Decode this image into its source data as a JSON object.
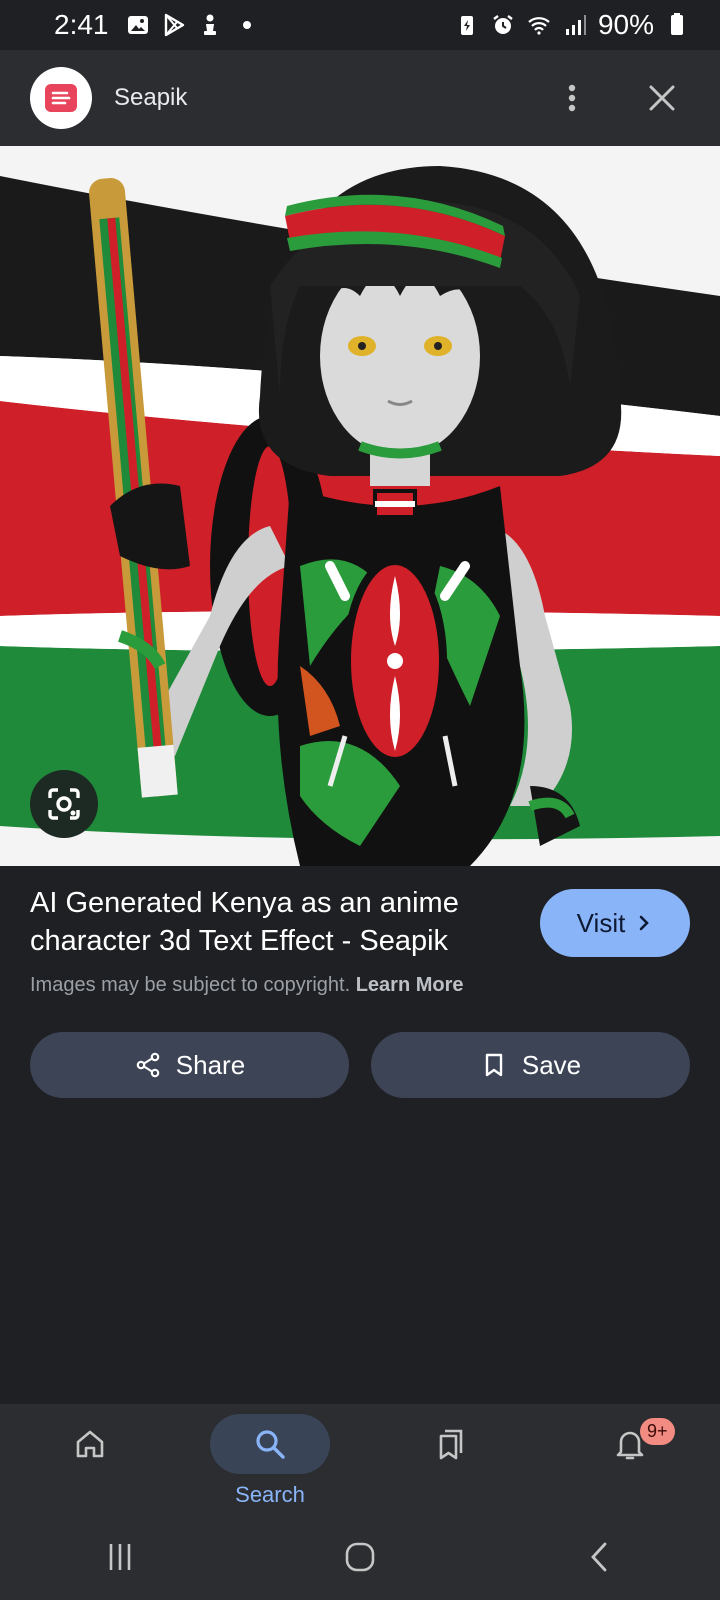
{
  "status_bar": {
    "time": "2:41",
    "battery": "90%",
    "icons": [
      "gallery-icon",
      "play-store-icon",
      "chess-icon",
      "battery-saver-icon",
      "alarm-icon",
      "wifi-icon",
      "signal-icon",
      "battery-icon"
    ]
  },
  "header": {
    "site_name": "Seapik",
    "more_icon": "more-vert-icon",
    "close_icon": "close-icon"
  },
  "image": {
    "lens_icon": "lens-search-icon"
  },
  "result": {
    "title": "AI Generated Kenya as an anime character 3d Text Effect - Seapik",
    "visit_label": "Visit",
    "copyright_text": "Images may be subject to copyright.",
    "learn_more": "Learn More"
  },
  "actions": {
    "share_label": "Share",
    "save_label": "Save"
  },
  "bottom_nav": {
    "search_label": "Search",
    "notification_badge": "9+"
  },
  "colors": {
    "accent": "#8ab4f8",
    "background": "#1f2024",
    "surface": "#2b2d31",
    "button": "#3c4455",
    "brand": "#e8455c"
  }
}
